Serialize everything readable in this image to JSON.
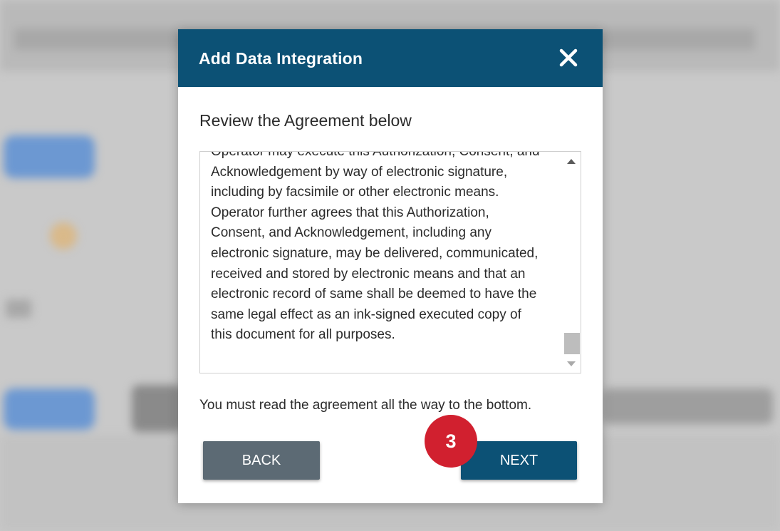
{
  "modal": {
    "title": "Add Data Integration",
    "close_icon": "close-icon",
    "subheading": "Review the Agreement below",
    "agreement_lines": [
      "Operator may execute this Authorization, Consent, and",
      "Acknowledgement by way of electronic signature,",
      "including by facsimile or other electronic means.",
      "Operator further agrees that this Authorization,",
      "Consent, and Acknowledgement, including any",
      "electronic signature, may be delivered, communicated,",
      "received and stored by electronic means and that an",
      "electronic record of same shall be deemed to have the",
      "same legal effect as an ink-signed executed copy of",
      "this document for all purposes."
    ],
    "notice": "You must read the agreement all the way to the bottom.",
    "back_label": "BACK",
    "next_label": "NEXT"
  },
  "annotation": {
    "step_number": "3"
  },
  "colors": {
    "header": "#0c5175",
    "next_button": "#0c5175",
    "back_button": "#5c6a74",
    "step_badge": "#d1202f"
  }
}
